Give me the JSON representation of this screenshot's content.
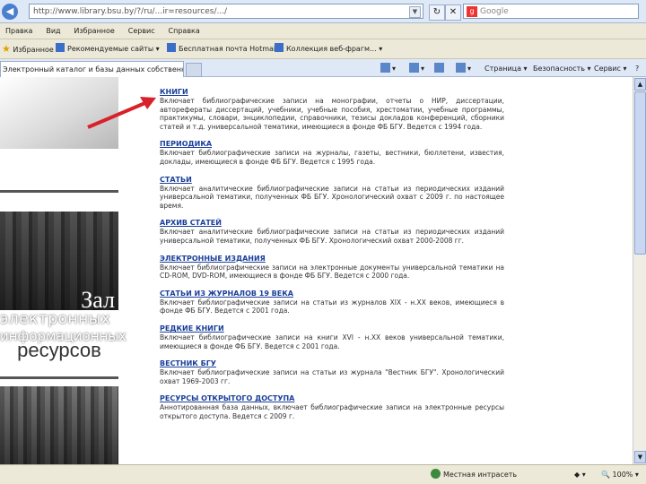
{
  "browser": {
    "address": "http://www.library.bsu.by/?/ru/...ir=resources/.../",
    "search_placeholder": "Google",
    "search_engine_icon": "google-icon"
  },
  "menu": [
    "Правка",
    "Вид",
    "Избранное",
    "Сервис",
    "Справка"
  ],
  "favorites": {
    "label": "Избранное",
    "items": [
      "Рекомендуемые сайты ▾",
      "Бесплатная почта Hotmail",
      "Коллекция веб-фрагм... ▾"
    ]
  },
  "tab": {
    "title": "Электронный каталог и базы данных собственн-о?..."
  },
  "toolbar": {
    "page": "Страница ▾",
    "safety": "Безопасность ▾",
    "tools": "Сервис ▾",
    "help": "?"
  },
  "left": {
    "banner_line1": "Зал",
    "banner_line2": "электронных",
    "banner_line3": "информационных",
    "banner_line4": "ресурсов"
  },
  "entries": [
    {
      "title": "Книги",
      "desc": "Включает библиографические записи на монографии, отчеты о НИР, диссертации, авторефераты диссертаций, учебники, учебные пособия, хрестоматии, учебные программы, практикумы, словари, энциклопедии, справочники, тезисы докладов конференций, сборники статей и т.д. универсальной тематики, имеющиеся в фонде ФБ БГУ. Ведется с 1994 года."
    },
    {
      "title": "Периодика",
      "desc": "Включает библиографические записи на журналы, газеты, вестники, бюллетени, известия, доклады, имеющиеся в фонде ФБ БГУ. Ведется с 1995 года."
    },
    {
      "title": "Статьи",
      "desc": "Включает аналитические библиографические записи на статьи из периодических изданий универсальной тематики, полученных ФБ БГУ. Хронологический охват с 2009 г. по настоящее время."
    },
    {
      "title": "Архив статей",
      "desc": "Включает аналитические библиографические записи на статьи из периодических изданий универсальной тематики, полученных ФБ БГУ. Хронологический охват 2000-2008 гг."
    },
    {
      "title": "Электронные издания",
      "desc": "Включает библиографические записи на электронные документы универсальной тематики на CD-ROM, DVD-ROM, имеющиеся в фонде ФБ БГУ. Ведется с 2000 года."
    },
    {
      "title": "Статьи из журналов 19 века",
      "desc": "Включает библиографические записи на статьи из журналов XIX - н.XX веков, имеющиеся в фонде ФБ БГУ. Ведется с 2001 года."
    },
    {
      "title": "Редкие книги",
      "desc": "Включает библиографические записи на книги XVI - н.XX веков универсальной тематики, имеющиеся в фонде ФБ БГУ. Ведется с 2001 года."
    },
    {
      "title": "Вестник БГУ",
      "desc": "Включает библиографические записи на статьи из журнала \"Вестник БГУ\". Хронологический охват 1969-2003 гг."
    },
    {
      "title": "Ресурсы открытого доступа",
      "desc": "Аннотированная база данных, включает библиографические записи на электронные ресурсы открытого доступа. Ведется с 2009 г."
    }
  ],
  "status": {
    "zone": "Местная интрасеть",
    "zoom": "100%"
  },
  "colors": {
    "link": "#1a3f9a",
    "arrow": "#d8212a"
  }
}
